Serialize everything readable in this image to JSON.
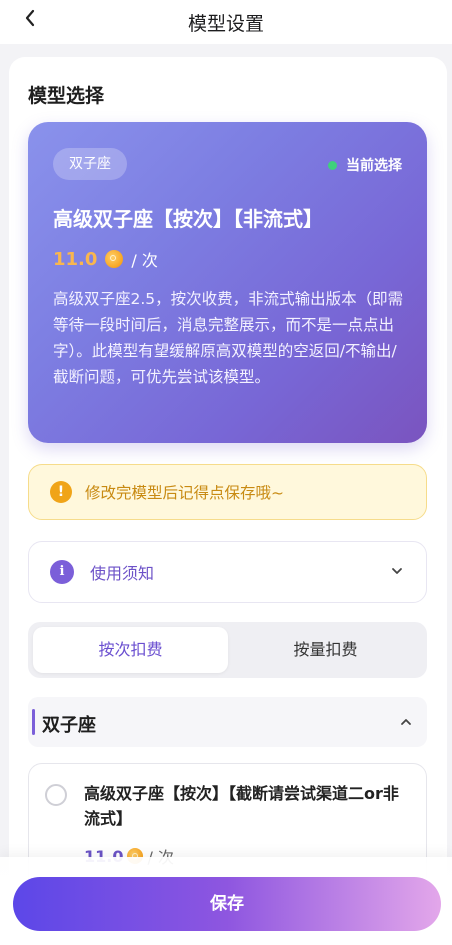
{
  "header": {
    "title": "模型设置",
    "back_icon": "chevron-left-icon"
  },
  "section": {
    "title": "模型选择"
  },
  "current_model": {
    "tag": "双子座",
    "status_label": "当前选择",
    "status_color": "#3fd07c",
    "name": "高级双子座【按次】【非流式】",
    "price": "11.0",
    "price_unit": "/ 次",
    "description": "高级双子座2.5，按次收费，非流式输出版本（即需等待一段时间后，消息完整展示，而不是一点点出字）。此模型有望缓解原高双模型的空返回/不输出/截断问题，可优先尝试该模型。"
  },
  "notice": {
    "text": "修改完模型后记得点保存哦~",
    "icon": "exclamation-icon"
  },
  "usage": {
    "label": "使用须知",
    "icon": "info-icon",
    "chevron": "chevron-down-icon"
  },
  "billing_tabs": [
    {
      "label": "按次扣费",
      "selected": true
    },
    {
      "label": "按量扣费",
      "selected": false
    }
  ],
  "group": {
    "label": "双子座",
    "expanded": true
  },
  "options": [
    {
      "name": "高级双子座【按次】【截断请尝试渠道二or非流式】",
      "price": "11.0",
      "price_unit": "/ 次",
      "selected": false
    }
  ],
  "footer": {
    "save_label": "保存"
  },
  "colors": {
    "accent": "#6a4fd0",
    "price": "#f9b64f",
    "notice_text": "#c88a12"
  }
}
